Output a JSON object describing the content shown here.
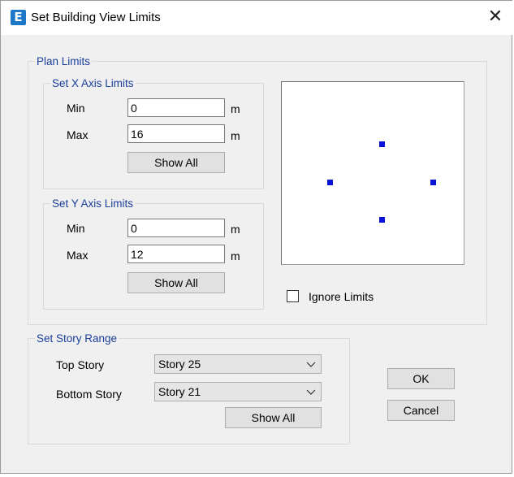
{
  "window": {
    "title": "Set Building View Limits",
    "icon": "etabs-app-icon",
    "close_glyph": "✕"
  },
  "plan_limits": {
    "legend": "Plan Limits",
    "x_axis": {
      "legend": "Set X Axis Limits",
      "min_label": "Min",
      "min_value": "0",
      "max_label": "Max",
      "max_value": "16",
      "unit": "m",
      "show_all": "Show All"
    },
    "y_axis": {
      "legend": "Set Y Axis Limits",
      "min_label": "Min",
      "min_value": "0",
      "max_label": "Max",
      "max_value": "12",
      "unit": "m",
      "show_all": "Show All"
    },
    "preview": {
      "marker_color": "#0a12d6",
      "markers": [
        "top-marker",
        "left-marker",
        "right-marker",
        "bottom-marker"
      ]
    },
    "ignore_limits": {
      "label": "Ignore Limits",
      "checked": false
    }
  },
  "story_range": {
    "legend": "Set Story Range",
    "top_label": "Top Story",
    "top_value": "Story 25",
    "bottom_label": "Bottom Story",
    "bottom_value": "Story 21",
    "show_all": "Show All"
  },
  "actions": {
    "ok": "OK",
    "cancel": "Cancel"
  },
  "colors": {
    "legend_text": "#1a3e9a",
    "dialog_bg": "#f0f0f0",
    "button_bg": "#e1e1e1"
  }
}
